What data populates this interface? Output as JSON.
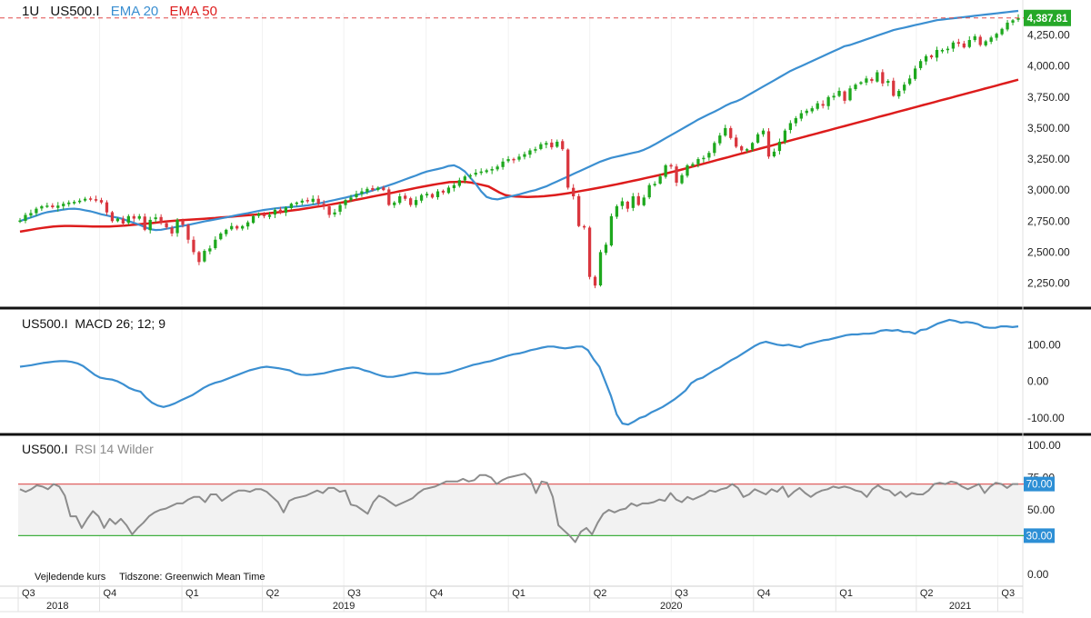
{
  "header": {
    "interval": "1U",
    "symbol": "US500.I",
    "ema20_label": "EMA 20",
    "ema50_label": "EMA 50"
  },
  "footer": {
    "note": "Vejledende kurs",
    "timezone": "Tidszone: Greenwich Mean Time"
  },
  "colors": {
    "up": "#1ea81e",
    "down": "#d9363e",
    "ema20": "#3b8fd1",
    "ema50": "#dd1c1c",
    "macd": "#3b8fd1",
    "rsi": "#8c8c8c",
    "last_price_bg": "#25a828",
    "rsi_badge_bg": "#2d8fd5",
    "rsi_upper_line": "#e06060",
    "rsi_lower_line": "#40b040"
  },
  "chart_data": [
    {
      "type": "candlestick",
      "title": "US500.I",
      "last_price_label": "4,387.81",
      "last_price": 4387.81,
      "ylim": [
        2100,
        4430
      ],
      "y_ticks": [
        2250,
        2500,
        2750,
        3000,
        3250,
        3500,
        3750,
        4000,
        4250
      ],
      "y_tick_labels": [
        "2,250.00",
        "2,500.00",
        "2,750.00",
        "3,000.00",
        "3,250.00",
        "3,500.00",
        "3,750.00",
        "4,000.00",
        "4,250.00"
      ],
      "x_start": "2018-07-02",
      "x_end": "2021-07-26",
      "series": [
        {
          "name": "US500.I",
          "close": [
            2755,
            2800,
            2815,
            2850,
            2870,
            2875,
            2862,
            2875,
            2890,
            2900,
            2905,
            2915,
            2930,
            2925,
            2915,
            2900,
            2820,
            2750,
            2770,
            2730,
            2790,
            2770,
            2790,
            2680,
            2760,
            2780,
            2740,
            2700,
            2650,
            2760,
            2720,
            2600,
            2500,
            2420,
            2510,
            2530,
            2600,
            2650,
            2680,
            2710,
            2690,
            2710,
            2740,
            2790,
            2810,
            2790,
            2800,
            2840,
            2820,
            2860,
            2890,
            2900,
            2915,
            2910,
            2930,
            2890,
            2870,
            2800,
            2820,
            2880,
            2920,
            2940,
            2970,
            2990,
            3010,
            3000,
            3020,
            3000,
            2880,
            2900,
            2950,
            2930,
            2880,
            2920,
            2960,
            2970,
            2940,
            2990,
            2980,
            3020,
            3040,
            3080,
            3110,
            3120,
            3140,
            3150,
            3160,
            3170,
            3190,
            3230,
            3250,
            3240,
            3270,
            3290,
            3320,
            3330,
            3370,
            3380,
            3345,
            3390,
            3330,
            3020,
            2950,
            2710,
            2700,
            2300,
            2230,
            2500,
            2560,
            2790,
            2870,
            2910,
            2850,
            2950,
            2880,
            2940,
            3040,
            3050,
            3110,
            3200,
            3190,
            3060,
            3120,
            3200,
            3210,
            3250,
            3260,
            3300,
            3380,
            3440,
            3500,
            3420,
            3350,
            3320,
            3330,
            3380,
            3450,
            3480,
            3270,
            3310,
            3390,
            3480,
            3540,
            3580,
            3620,
            3640,
            3660,
            3700,
            3680,
            3750,
            3760,
            3800,
            3720,
            3820,
            3850,
            3870,
            3900,
            3880,
            3950,
            3860,
            3880,
            3760,
            3800,
            3850,
            3900,
            3980,
            4040,
            4080,
            4070,
            4130,
            4130,
            4140,
            4190,
            4180,
            4150,
            4210,
            4240,
            4170,
            4200,
            4230,
            4260,
            4300,
            4350,
            4369,
            4388
          ]
        },
        {
          "name": "EMA 20",
          "values": [
            2750,
            2765,
            2779,
            2794,
            2810,
            2822,
            2829,
            2836,
            2843,
            2849,
            2850,
            2846,
            2837,
            2829,
            2817,
            2805,
            2795,
            2786,
            2778,
            2767,
            2750,
            2736,
            2720,
            2702,
            2685,
            2678,
            2680,
            2688,
            2696,
            2705,
            2712,
            2720,
            2729,
            2738,
            2748,
            2756,
            2764,
            2772,
            2780,
            2789,
            2798,
            2806,
            2814,
            2823,
            2832,
            2840,
            2846,
            2852,
            2857,
            2861,
            2865,
            2868,
            2872,
            2877,
            2883,
            2891,
            2901,
            2911,
            2920,
            2930,
            2940,
            2950,
            2960,
            2971,
            2983,
            2997,
            3011,
            3025,
            3039,
            3054,
            3070,
            3086,
            3102,
            3118,
            3135,
            3150,
            3160,
            3170,
            3180,
            3195,
            3200,
            3180,
            3150,
            3100,
            3050,
            2990,
            2945,
            2930,
            2925,
            2935,
            2945,
            2955,
            2965,
            2978,
            2990,
            3000,
            3015,
            3030,
            3050,
            3070,
            3090,
            3110,
            3130,
            3150,
            3170,
            3190,
            3210,
            3230,
            3245,
            3260,
            3270,
            3280,
            3290,
            3300,
            3310,
            3325,
            3345,
            3368,
            3393,
            3418,
            3443,
            3468,
            3493,
            3518,
            3543,
            3568,
            3590,
            3612,
            3632,
            3655,
            3680,
            3700,
            3715,
            3735,
            3760,
            3785,
            3810,
            3835,
            3860,
            3885,
            3910,
            3935,
            3960,
            3980,
            4000,
            4020,
            4040,
            4060,
            4080,
            4100,
            4120,
            4140,
            4160,
            4170,
            4185,
            4200,
            4215,
            4230,
            4245,
            4260,
            4275,
            4290,
            4300,
            4310,
            4320,
            4330,
            4340,
            4350,
            4360,
            4370,
            4375,
            4380,
            4385,
            4390,
            4395,
            4400,
            4405,
            4410,
            4415,
            4420,
            4425,
            4430,
            4435,
            4440,
            4445
          ]
        },
        {
          "name": "EMA 50",
          "values": [
            2665,
            2672,
            2680,
            2688,
            2695,
            2701,
            2706,
            2709,
            2711,
            2711,
            2710,
            2709,
            2708,
            2707,
            2706,
            2706,
            2707,
            2709,
            2712,
            2715,
            2719,
            2723,
            2727,
            2731,
            2736,
            2741,
            2746,
            2750,
            2754,
            2757,
            2760,
            2763,
            2766,
            2769,
            2772,
            2775,
            2779,
            2782,
            2786,
            2790,
            2794,
            2798,
            2802,
            2806,
            2810,
            2815,
            2820,
            2825,
            2831,
            2837,
            2843,
            2850,
            2857,
            2864,
            2871,
            2878,
            2886,
            2894,
            2902,
            2910,
            2919,
            2928,
            2937,
            2946,
            2955,
            2964,
            2972,
            2981,
            2990,
            2999,
            3008,
            3017,
            3026,
            3034,
            3042,
            3050,
            3057,
            3064,
            3066,
            3067,
            3066,
            3060,
            3050,
            3040,
            3030,
            3005,
            2980,
            2960,
            2952,
            2948,
            2946,
            2945,
            2946,
            2948,
            2951,
            2955,
            2960,
            2966,
            2973,
            2980,
            2988,
            2996,
            3004,
            3012,
            3020,
            3029,
            3038,
            3047,
            3056,
            3066,
            3075,
            3085,
            3095,
            3105,
            3115,
            3125,
            3136,
            3147,
            3158,
            3170,
            3182,
            3194,
            3206,
            3218,
            3230,
            3242,
            3254,
            3266,
            3278,
            3290,
            3302,
            3314,
            3326,
            3338,
            3350,
            3362,
            3374,
            3386,
            3398,
            3410,
            3422,
            3434,
            3446,
            3458,
            3470,
            3482,
            3494,
            3506,
            3518,
            3530,
            3542,
            3554,
            3566,
            3578,
            3590,
            3602,
            3614,
            3626,
            3638,
            3650,
            3662,
            3674,
            3686,
            3698,
            3710,
            3722,
            3734,
            3746,
            3758,
            3770,
            3782,
            3794,
            3806,
            3818,
            3830,
            3842,
            3854,
            3866,
            3878,
            3890
          ]
        }
      ]
    },
    {
      "type": "line",
      "title": "US500.I",
      "subtitle": "MACD 26; 12; 9",
      "ylim": [
        -130,
        185
      ],
      "y_ticks": [
        -100,
        0,
        100
      ],
      "y_tick_labels": [
        "-100.00",
        "0.00",
        "100.00"
      ],
      "series": [
        {
          "name": "MACD",
          "values": [
            40,
            42,
            44,
            47,
            50,
            52,
            54,
            55,
            55,
            53,
            49,
            42,
            30,
            18,
            10,
            7,
            5,
            0,
            -8,
            -18,
            -24,
            -28,
            -45,
            -58,
            -66,
            -70,
            -66,
            -60,
            -52,
            -45,
            -38,
            -28,
            -18,
            -10,
            -4,
            0,
            6,
            12,
            18,
            24,
            30,
            34,
            38,
            40,
            38,
            36,
            33,
            30,
            22,
            18,
            17,
            18,
            20,
            22,
            26,
            30,
            33,
            36,
            38,
            36,
            30,
            26,
            20,
            15,
            12,
            12,
            15,
            18,
            22,
            24,
            22,
            20,
            20,
            20,
            22,
            25,
            30,
            35,
            40,
            45,
            48,
            52,
            55,
            60,
            65,
            70,
            74,
            76,
            80,
            85,
            88,
            92,
            95,
            95,
            92,
            90,
            92,
            95,
            95,
            85,
            60,
            40,
            0,
            -40,
            -90,
            -115,
            -118,
            -110,
            -100,
            -95,
            -85,
            -78,
            -70,
            -60,
            -50,
            -38,
            -25,
            -5,
            5,
            10,
            20,
            30,
            38,
            48,
            58,
            66,
            76,
            86,
            96,
            104,
            108,
            104,
            100,
            98,
            100,
            96,
            93,
            100,
            104,
            108,
            112,
            114,
            118,
            122,
            126,
            128,
            128,
            130,
            130,
            132,
            138,
            140,
            138,
            140,
            135,
            135,
            130,
            140,
            142,
            150,
            158,
            163,
            168,
            165,
            160,
            162,
            160,
            156,
            148,
            146,
            146,
            150,
            150,
            148,
            150
          ]
        }
      ]
    },
    {
      "type": "line",
      "title": "US500.I",
      "subtitle": "RSI 14 Wilder",
      "ylim": [
        0,
        100
      ],
      "y_ticks": [
        0,
        50,
        75,
        100
      ],
      "y_tick_labels": [
        "0.00",
        "50.00",
        "75.00",
        "100.00"
      ],
      "levels": [
        70,
        30
      ],
      "level_labels": [
        "70.00",
        "30.00"
      ],
      "series": [
        {
          "name": "RSI 14",
          "values": [
            66,
            64,
            66,
            69,
            68,
            66,
            70,
            68,
            61,
            45,
            45,
            36,
            43,
            49,
            45,
            36,
            43,
            39,
            43,
            38,
            31,
            36,
            40,
            45,
            48,
            50,
            51,
            53,
            55,
            55,
            58,
            60,
            60,
            56,
            62,
            62,
            57,
            60,
            63,
            65,
            65,
            64,
            66,
            66,
            64,
            60,
            56,
            48,
            57,
            59,
            60,
            61,
            63,
            65,
            63,
            67,
            67,
            64,
            65,
            54,
            53,
            50,
            47,
            56,
            61,
            59,
            56,
            53,
            55,
            57,
            59,
            63,
            66,
            67,
            68,
            70,
            72,
            72,
            72,
            74,
            72,
            73,
            77,
            77,
            75,
            70,
            73,
            75,
            76,
            77,
            78,
            74,
            63,
            72,
            71,
            60,
            38,
            34,
            30,
            25,
            33,
            36,
            31,
            40,
            47,
            50,
            48,
            50,
            51,
            55,
            53,
            55,
            55,
            56,
            58,
            57,
            63,
            58,
            56,
            60,
            58,
            60,
            62,
            65,
            64,
            66,
            67,
            70,
            67,
            60,
            62,
            66,
            64,
            62,
            66,
            64,
            68,
            60,
            64,
            67,
            63,
            60,
            63,
            65,
            66,
            68,
            67,
            68,
            67,
            65,
            64,
            60,
            66,
            69,
            66,
            65,
            61,
            64,
            60,
            63,
            62,
            62,
            65,
            70,
            71,
            70,
            72,
            71,
            68,
            66,
            68,
            70,
            63,
            68,
            71,
            70,
            67,
            70,
            70
          ]
        }
      ]
    },
    {
      "type": "axis",
      "quarter_labels": [
        "Q3",
        "Q4",
        "Q1",
        "Q2",
        "Q3",
        "Q4",
        "Q1",
        "Q2",
        "Q3",
        "Q4",
        "Q1",
        "Q2",
        "Q3"
      ],
      "quarter_dates": [
        "2018-07-01",
        "2018-10-01",
        "2019-01-01",
        "2019-04-01",
        "2019-07-01",
        "2019-10-01",
        "2020-01-01",
        "2020-04-01",
        "2020-07-01",
        "2020-10-01",
        "2021-01-01",
        "2021-04-01",
        "2021-07-01"
      ],
      "year_labels": [
        "2018",
        "2019",
        "2020",
        "2021"
      ],
      "year_dates": [
        "2018-08-15",
        "2019-07-01",
        "2020-07-01",
        "2021-05-20"
      ]
    }
  ]
}
